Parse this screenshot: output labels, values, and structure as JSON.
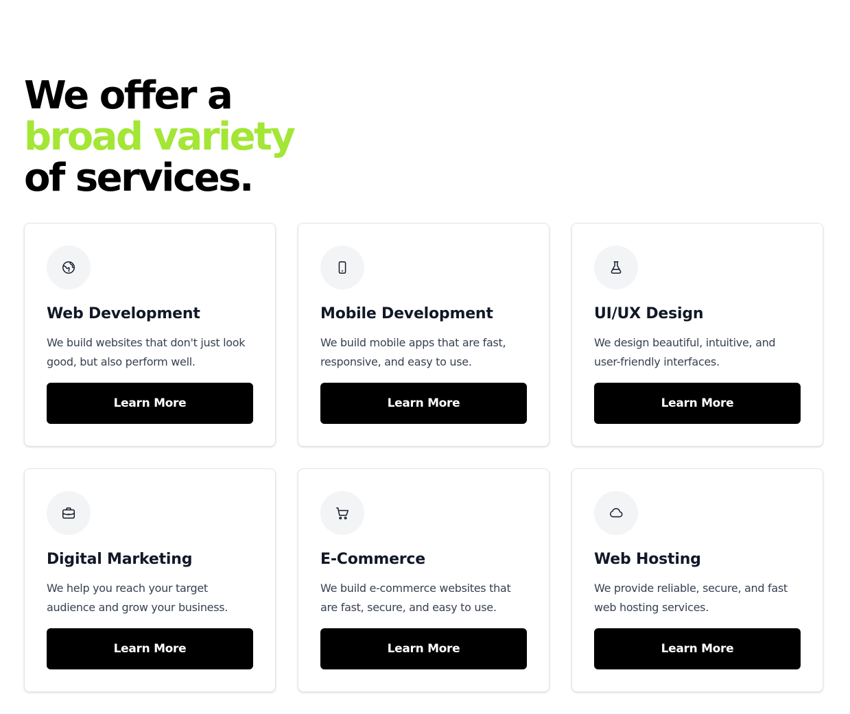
{
  "headline": {
    "line1": "We offer a",
    "line2": "broad variety",
    "line3": "of services."
  },
  "colors": {
    "accent": "#a3e635",
    "button_bg": "#000000",
    "icon_bg": "#f3f4f6"
  },
  "services": [
    {
      "icon": "globe-icon",
      "title": "Web Development",
      "description": "We build websites that don't just look good, but also perform well.",
      "button_label": "Learn More"
    },
    {
      "icon": "mobile-phone-icon",
      "title": "Mobile Development",
      "description": "We build mobile apps that are fast, responsive, and easy to use.",
      "button_label": "Learn More"
    },
    {
      "icon": "flask-icon",
      "title": "UI/UX Design",
      "description": "We design beautiful, intuitive, and user-friendly interfaces.",
      "button_label": "Learn More"
    },
    {
      "icon": "briefcase-icon",
      "title": "Digital Marketing",
      "description": "We help you reach your target audience and grow your business.",
      "button_label": "Learn More"
    },
    {
      "icon": "shopping-cart-icon",
      "title": "E-Commerce",
      "description": "We build e-commerce websites that are fast, secure, and easy to use.",
      "button_label": "Learn More"
    },
    {
      "icon": "cloud-icon",
      "title": "Web Hosting",
      "description": "We provide reliable, secure, and fast web hosting services.",
      "button_label": "Learn More"
    }
  ]
}
